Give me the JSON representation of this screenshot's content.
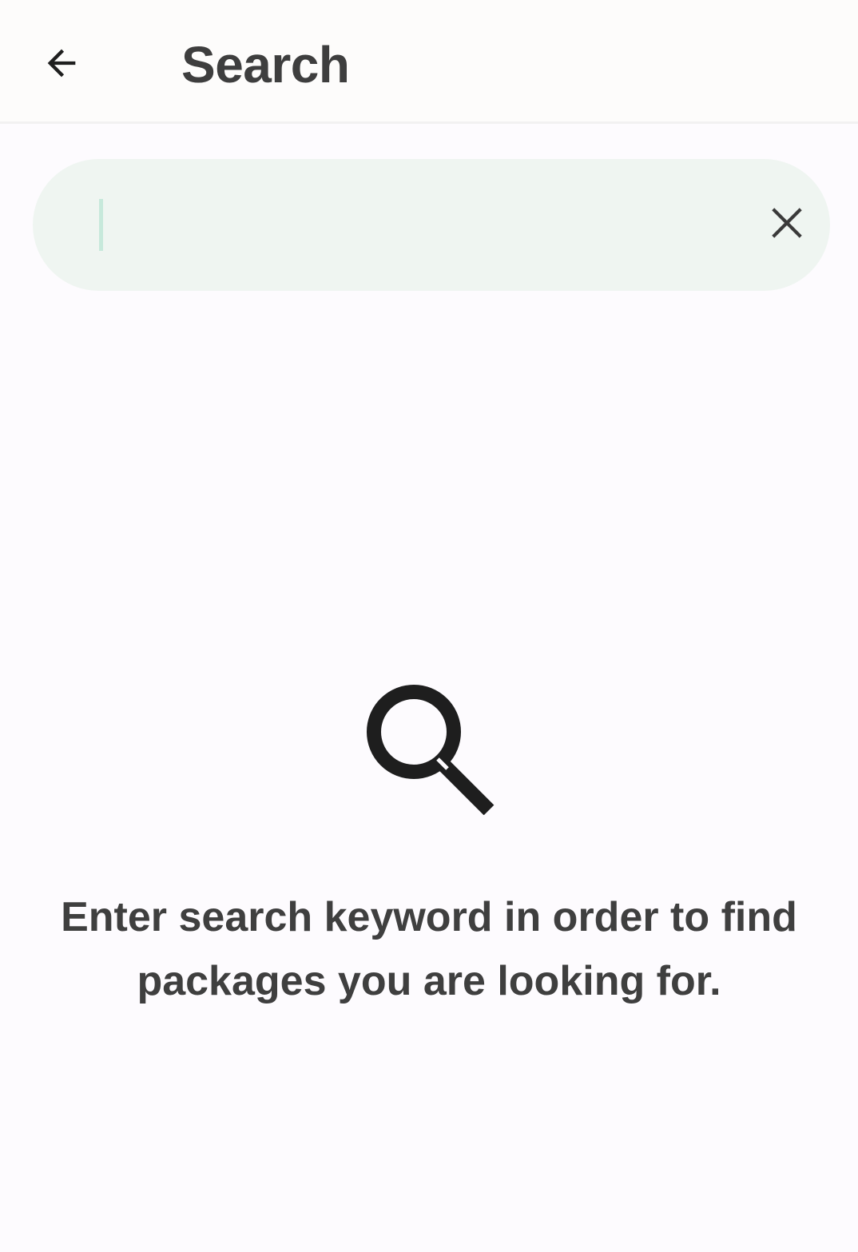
{
  "header": {
    "title": "Search",
    "back_icon": "arrow-back-icon"
  },
  "search": {
    "value": "",
    "placeholder": "",
    "clear_icon": "close-icon"
  },
  "empty_state": {
    "icon": "search-icon",
    "message": "Enter search keyword in order to find packages you are looking for."
  },
  "colors": {
    "background": "#fdfbfe",
    "search_field_bg": "#eff5f1",
    "caret": "#c7e9db",
    "text": "#3e3e3e"
  }
}
